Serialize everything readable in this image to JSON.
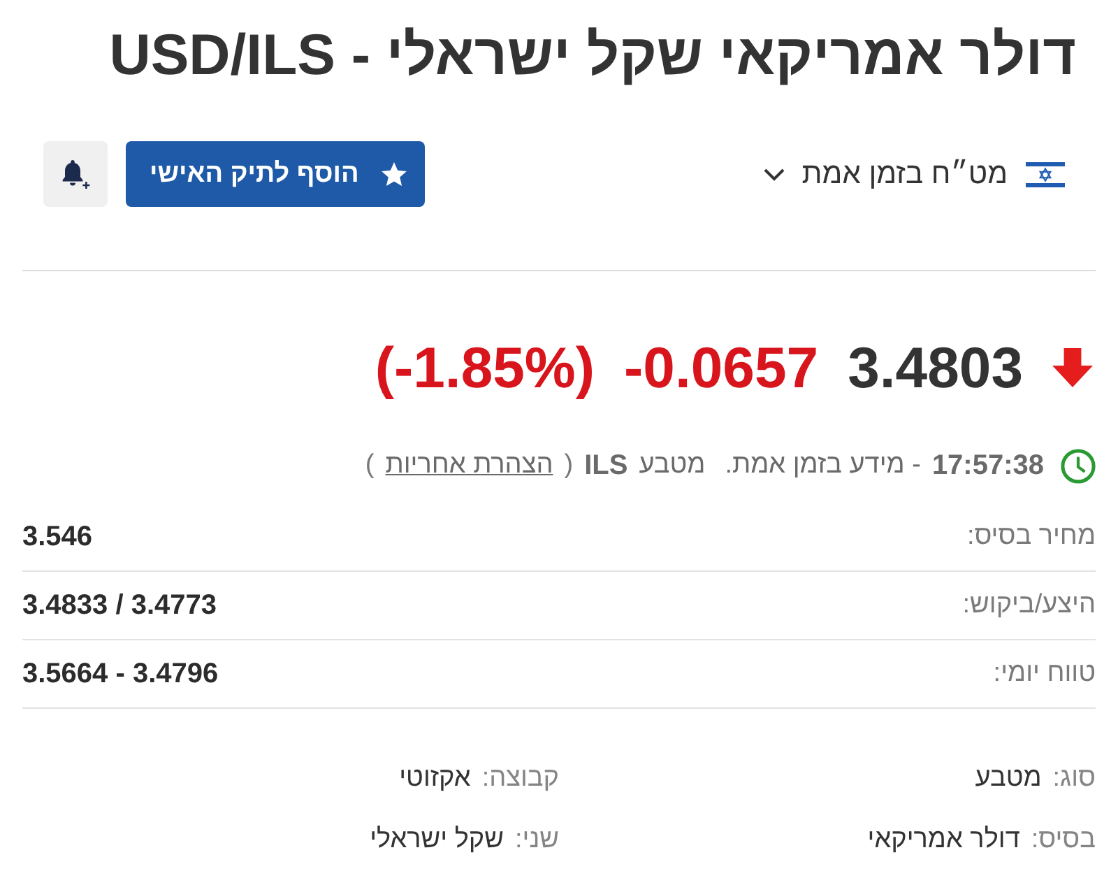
{
  "title": "דולר אמריקאי שקל ישראלי - USD/ILS",
  "market_selector": {
    "label": "מט״ח בזמן אמת"
  },
  "portfolio_button": {
    "label": "הוסף לתיק האישי"
  },
  "quote": {
    "last": "3.4803",
    "change": "-0.0657",
    "change_percent": "(-1.85%)",
    "falling": true
  },
  "status": {
    "time": "17:57:38",
    "note": "- מידע בזמן אמת.",
    "currency_label": "מטבע",
    "currency": "ILS",
    "disclaimer_open": "(",
    "disclaimer": "הצהרת אחריות",
    "disclaimer_close": ")"
  },
  "stats": [
    {
      "label": "מחיר בסיס:",
      "value": "3.546"
    },
    {
      "label": "היצע/ביקוש:",
      "value": "3.4833 / 3.4773"
    },
    {
      "label": "טווח יומי:",
      "value": "3.5664 - 3.4796"
    }
  ],
  "details": [
    {
      "label": "סוג:",
      "value": "מטבע"
    },
    {
      "label": "קבוצה:",
      "value": "אקזוטי"
    },
    {
      "label": "בסיס:",
      "value": "דולר אמריקאי"
    },
    {
      "label": "שני:",
      "value": "שקל ישראלי"
    }
  ]
}
